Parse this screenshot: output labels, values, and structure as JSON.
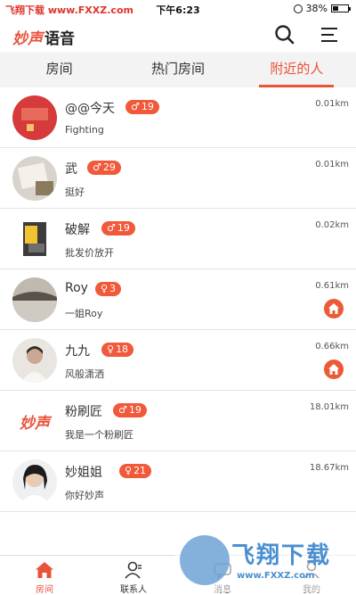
{
  "status_bar": {
    "watermark": "飞翔下载 www.FXXZ.com",
    "time": "下午6:23",
    "battery_text": "38%",
    "battery_level": 0.38
  },
  "header": {
    "brand": "妙声",
    "brand_sub": "语音",
    "icons": [
      "search-icon",
      "menu-icon"
    ]
  },
  "tabs": [
    {
      "label": "房间",
      "active": false
    },
    {
      "label": "热门房间",
      "active": false
    },
    {
      "label": "附近的人",
      "active": true
    }
  ],
  "users": [
    {
      "name": "@@今天",
      "gender": "male",
      "gender_symbol": "♂",
      "age": "19",
      "signature": "Fighting",
      "distance": "0.01km",
      "in_room": false
    },
    {
      "name": "武",
      "gender": "male",
      "gender_symbol": "♂",
      "age": "29",
      "signature": "挺好",
      "distance": "0.01km",
      "in_room": false
    },
    {
      "name": "破解",
      "gender": "male",
      "gender_symbol": "♂",
      "age": "19",
      "signature": "批发价放开",
      "distance": "0.02km",
      "in_room": false
    },
    {
      "name": "Roy",
      "gender": "female",
      "gender_symbol": "♀",
      "age": "3",
      "signature": "一姐Roy",
      "distance": "0.61km",
      "in_room": true
    },
    {
      "name": "九九",
      "gender": "female",
      "gender_symbol": "♀",
      "age": "18",
      "signature": "风般潇洒",
      "distance": "0.66km",
      "in_room": true
    },
    {
      "name": "粉刷匠",
      "gender": "male",
      "gender_symbol": "♂",
      "age": "19",
      "signature": "我是一个粉刷匠",
      "distance": "18.01km",
      "in_room": false
    },
    {
      "name": "妙姐姐",
      "gender": "female",
      "gender_symbol": "♀",
      "age": "21",
      "signature": "你好妙声",
      "distance": "18.67km",
      "in_room": false
    }
  ],
  "avatar_brand_text": "妙声",
  "bottom_nav": [
    {
      "label": "房间",
      "icon": "home-icon",
      "active": true
    },
    {
      "label": "联系人",
      "icon": "contacts-icon",
      "active": false
    },
    {
      "label": "消息",
      "icon": "message-icon",
      "active": false
    },
    {
      "label": "我的",
      "icon": "profile-icon",
      "active": false
    }
  ],
  "watermark": {
    "text": "飞翔下载",
    "url": "www.FXXZ.com"
  },
  "colors": {
    "accent": "#e8533a",
    "badge": "#f0593a",
    "tab_bg": "#f3f3f3"
  }
}
